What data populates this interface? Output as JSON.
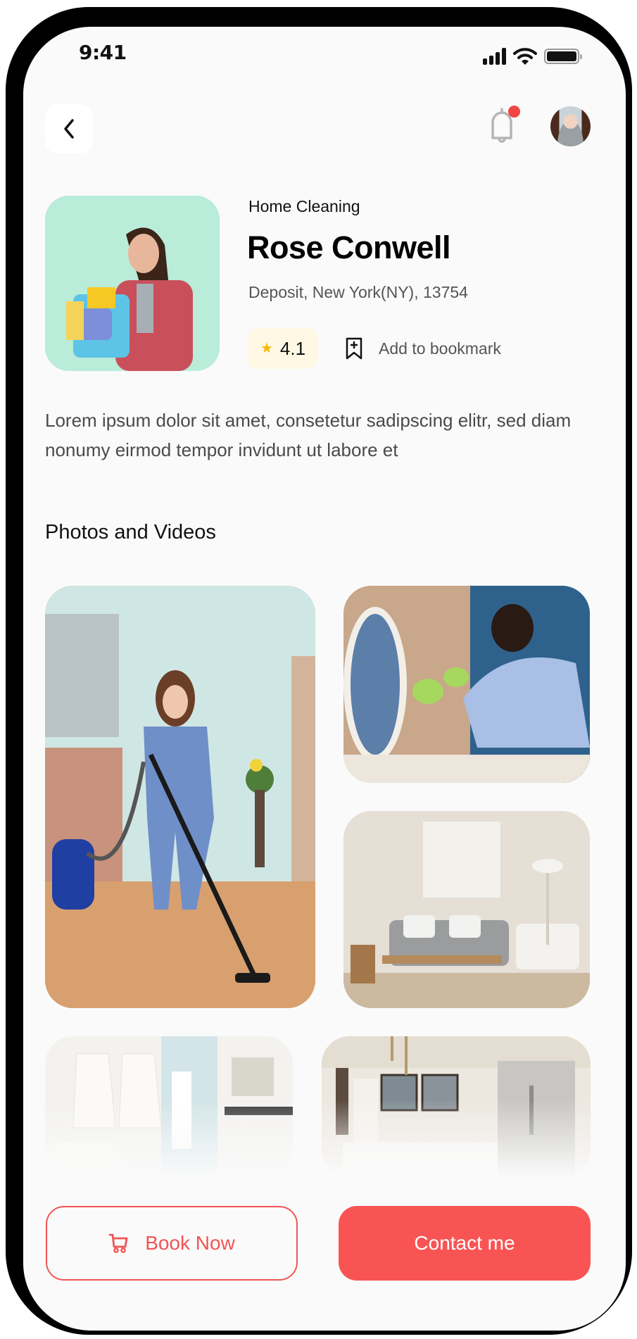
{
  "status_bar": {
    "time": "9:41",
    "icons": [
      "signal-icon",
      "wifi-icon",
      "battery-icon"
    ]
  },
  "header": {
    "back_icon": "chevron-left-icon",
    "notification_icon": "bell-icon",
    "has_unread_notification": true,
    "avatar_alt": "User avatar"
  },
  "profile": {
    "photo_alt": "Woman holding cleaning bucket",
    "category": "Home Cleaning",
    "name": "Rose Conwell",
    "address": "Deposit, New York(NY), 13754",
    "rating": "4.1",
    "rating_icon": "star-icon",
    "bookmark_icon": "bookmark-plus-icon",
    "bookmark_label": "Add to bookmark"
  },
  "description": "Lorem ipsum dolor sit amet, consetetur sadipscing elitr, sed diam nonumy eirmod tempor invidunt ut labore et",
  "gallery": {
    "title": "Photos and Videos",
    "items": [
      {
        "alt": "Cleaner vacuuming a room"
      },
      {
        "alt": "Cleaner wiping a mirror"
      },
      {
        "alt": "Clean living room"
      },
      {
        "alt": "Bathroom with robes"
      },
      {
        "alt": "Modern kitchen"
      }
    ]
  },
  "actions": {
    "book_label": "Book Now",
    "book_icon": "cart-icon",
    "contact_label": "Contact me"
  },
  "colors": {
    "accent": "#f95454",
    "rating_bg": "#fff8e4",
    "star": "#f5b800",
    "profile_bg": "#b9ecd9"
  }
}
